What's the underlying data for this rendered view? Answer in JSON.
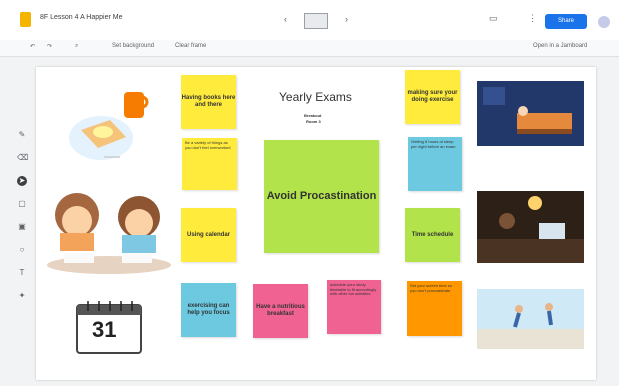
{
  "app": {
    "title": "8F Lesson 4 A Happier Me",
    "share_label": "Share"
  },
  "toolbar": {
    "items": [
      "Set background",
      "Clear frame"
    ],
    "right_label": "Open in a Jamboard"
  },
  "board": {
    "title": "Yearly Exams",
    "subtitle_line1": "Breakout",
    "subtitle_line2": "Room 3",
    "calendar_number": "31"
  },
  "notes": {
    "having_books": "Having books here and there",
    "be_variety": "Be a variety of things as you don't feel overworked",
    "using_calendar": "Using calendar",
    "exercising": "exercising can help you focus",
    "nutritious": "Have a nutritious breakfast",
    "schedule_study": "schedule your study timetable to fit accordingly with other fun activities",
    "making_sure": "making sure your doing exercise",
    "getting_sleep": "Getting 8 hours of sleep per night before an exam",
    "time_schedule": "Time schedule",
    "set_alarm": "Set your screen time so you don't procrastinate",
    "avoid": "Avoid Procastination"
  },
  "colors": {
    "yellow": "#ffeb3b",
    "green": "#b2e34a",
    "blue": "#6cc9e0",
    "pink": "#f06292",
    "orange": "#ff9800",
    "share": "#1a73e8"
  }
}
